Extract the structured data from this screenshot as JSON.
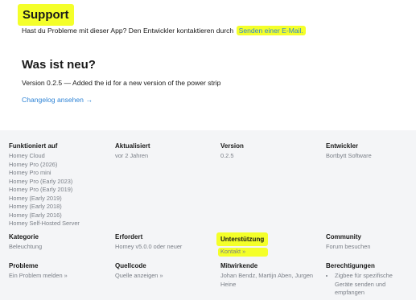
{
  "support": {
    "title": "Support",
    "text": "Hast du Probleme mit dieser App? Den Entwickler kontaktieren durch",
    "email_link": "Senden einer E-Mail."
  },
  "whats_new": {
    "title": "Was ist neu?",
    "version_text": "Version 0.2.5 — Added the id for a new version of the power strip",
    "changelog_link": "Changelog ansehen",
    "changelog_arrow": "→"
  },
  "meta": {
    "works_on": {
      "label": "Funktioniert auf",
      "items": [
        "Homey Cloud",
        "Homey Pro (2026)",
        "Homey Pro mini",
        "Homey Pro (Early 2023)",
        "Homey Pro (Early 2019)",
        "Homey (Early 2019)",
        "Homey (Early 2018)",
        "Homey (Early 2016)",
        "Homey Self-Hosted Server"
      ]
    },
    "updated": {
      "label": "Aktualisiert",
      "value": "vor 2 Jahren"
    },
    "version": {
      "label": "Version",
      "value": "0.2.5"
    },
    "developer": {
      "label": "Entwickler",
      "value": "Bortbytt Software"
    },
    "category": {
      "label": "Kategorie",
      "value": "Beleuchtung"
    },
    "requires": {
      "label": "Erfordert",
      "value": "Homey v5.0.0 oder neuer"
    },
    "support": {
      "label": "Unterstützung",
      "value": "Kontakt »"
    },
    "community": {
      "label": "Community",
      "value": "Forum besuchen"
    },
    "problems": {
      "label": "Probleme",
      "value": "Ein Problem melden »"
    },
    "source": {
      "label": "Quellcode",
      "value": "Quelle anzeigen »"
    },
    "contributors": {
      "label": "Mitwirkende",
      "value": "Johan Bendz, Martijn Aben, Jurgen Heine"
    },
    "permissions": {
      "label": "Berechtigungen",
      "items": [
        "Zigbee für spezifische Geräte senden und empfangen"
      ]
    }
  },
  "colors": {
    "highlight": "#f4ff2a",
    "link": "#2f84d6",
    "footer_bg": "#f4f5f7",
    "muted_text": "#7a7f87"
  }
}
